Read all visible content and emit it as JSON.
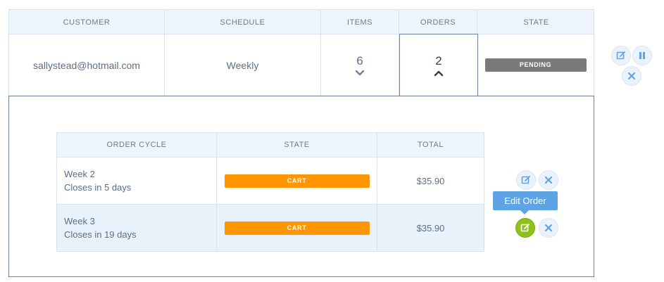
{
  "outer": {
    "headers": [
      "CUSTOMER",
      "SCHEDULE",
      "ITEMS",
      "ORDERS",
      "STATE"
    ],
    "row": {
      "customer": "sallystead@hotmail.com",
      "schedule": "Weekly",
      "items": "6",
      "orders": "2",
      "state": "PENDING"
    },
    "row_actions": [
      "edit-icon",
      "pause-icon",
      "close-icon"
    ]
  },
  "inner": {
    "headers": [
      "ORDER CYCLE",
      "STATE",
      "TOTAL"
    ],
    "rows": [
      {
        "cycle_line1": "Week 2",
        "cycle_line2": "Closes in 5 days",
        "state": "CART",
        "total": "$35.90"
      },
      {
        "cycle_line1": "Week 3",
        "cycle_line2": "Closes in 19 days",
        "state": "CART",
        "total": "$35.90"
      }
    ]
  },
  "tooltip": {
    "label": "Edit Order"
  },
  "colors": {
    "accent_blue": "#5ea4e4",
    "cart_orange": "#ff9500",
    "pending_gray": "#7a7a7a",
    "edit_green": "#8ec21a"
  }
}
